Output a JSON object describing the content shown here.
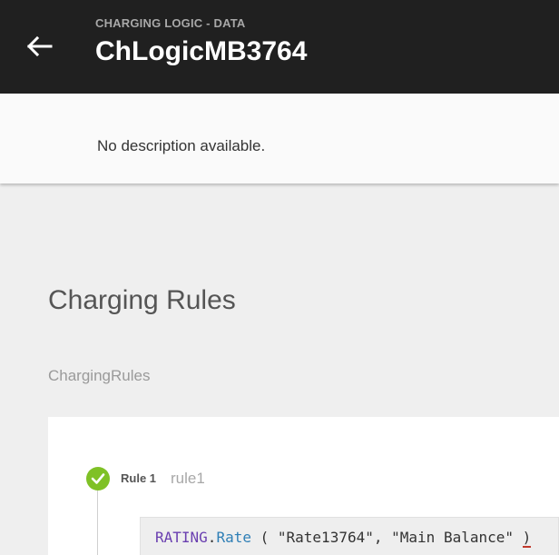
{
  "header": {
    "eyebrow": "CHARGING LOGIC - DATA",
    "title": "ChLogicMB3764",
    "back_icon": "arrow-left-icon"
  },
  "description": {
    "text": "No description available."
  },
  "section": {
    "title": "Charging Rules",
    "subtitle": "ChargingRules"
  },
  "rules": [
    {
      "label": "Rule 1",
      "name": "rule1",
      "status_icon": "check-circle-icon",
      "status_color": "#7fc126",
      "code": {
        "namespace": "RATING",
        "dot": ".",
        "function": "Rate",
        "open_paren": "(",
        "arg1": "\"Rate13764\"",
        "comma": ",",
        "arg2": "\"Main Balance\"",
        "close_paren": ")"
      }
    }
  ],
  "colors": {
    "header_bg": "#202020",
    "page_bg": "#efefef",
    "accent_green": "#7fc126",
    "code_namespace": "#6a3fb0",
    "code_function": "#2f7fb6"
  }
}
